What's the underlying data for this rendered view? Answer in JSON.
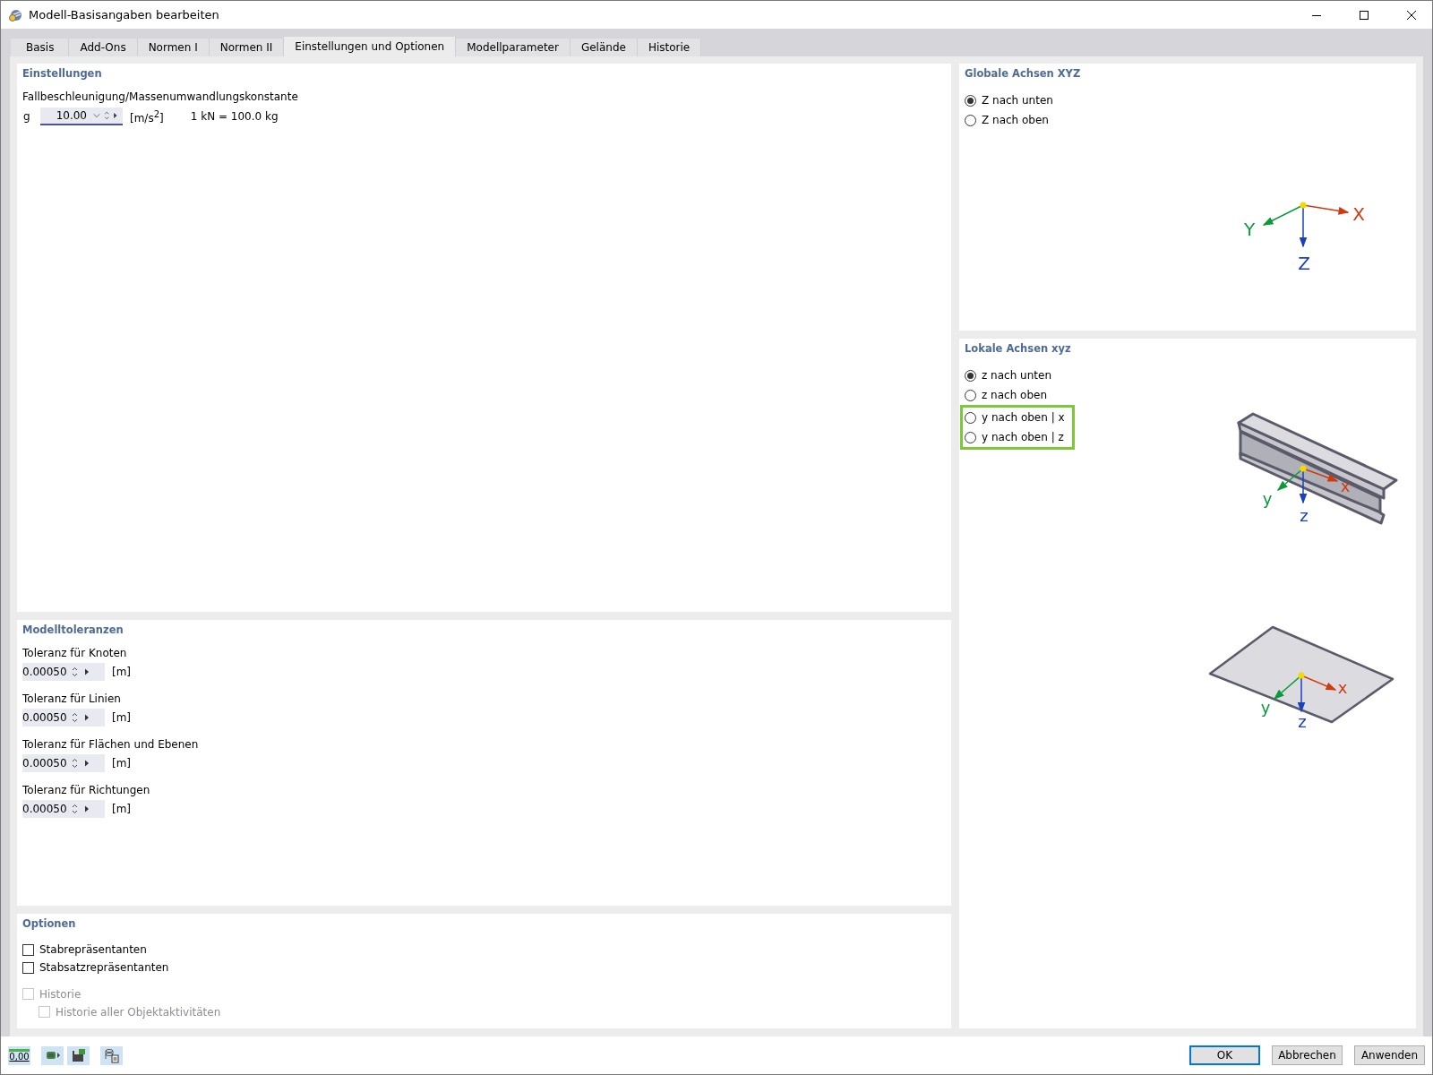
{
  "window": {
    "title": "Modell-Basisangaben bearbeiten"
  },
  "tabs": [
    {
      "label": "Basis",
      "selected": false
    },
    {
      "label": "Add-Ons",
      "selected": false
    },
    {
      "label": "Normen I",
      "selected": false
    },
    {
      "label": "Normen II",
      "selected": false
    },
    {
      "label": "Einstellungen und Optionen",
      "selected": true
    },
    {
      "label": "Modellparameter",
      "selected": false
    },
    {
      "label": "Gelände",
      "selected": false
    },
    {
      "label": "Historie",
      "selected": false
    }
  ],
  "settings": {
    "title": "Einstellungen",
    "label": "Fallbeschleunigung/Massenumwandlungskonstante",
    "symbol": "g",
    "value": "10.00",
    "focused": true,
    "unit": "[m/s$^{2}$]",
    "note": "1 kN = 100.0 kg"
  },
  "tolerances": {
    "title": "Modelltoleranzen",
    "items": [
      {
        "label": "Toleranz für Knoten",
        "value": "0.00050",
        "unit": "[m]"
      },
      {
        "label": "Toleranz für Linien",
        "value": "0.00050",
        "unit": "[m]"
      },
      {
        "label": "Toleranz für Flächen und Ebenen",
        "value": "0.00050",
        "unit": "[m]"
      },
      {
        "label": "Toleranz für Richtungen",
        "value": "0.00050",
        "unit": "[m]"
      }
    ]
  },
  "options": {
    "title": "Optionen",
    "items": [
      {
        "label": "Stabrepräsentanten",
        "checked": false,
        "disabled": false
      },
      {
        "label": "Stabsatzrepräsentanten",
        "checked": false,
        "disabled": false
      },
      {
        "label": "Historie",
        "checked": false,
        "disabled": true,
        "children": [
          {
            "label": "Historie aller Objektaktivitäten",
            "checked": false,
            "disabled": true
          }
        ]
      }
    ]
  },
  "global_axes": {
    "title": "Globale Achsen XYZ",
    "options": [
      {
        "label": "Z nach unten",
        "selected": true
      },
      {
        "label": "Z nach oben",
        "selected": false
      }
    ],
    "axis_labels": [
      "X",
      "Y",
      "Z"
    ]
  },
  "local_axes": {
    "title": "Lokale Achsen xyz",
    "options": [
      {
        "label": "z nach unten",
        "selected": true,
        "highlighted": false
      },
      {
        "label": "z nach oben",
        "selected": false,
        "highlighted": false
      },
      {
        "label": "y nach oben | x",
        "selected": false,
        "highlighted": true
      },
      {
        "label": "y nach oben | z",
        "selected": false,
        "highlighted": true
      }
    ],
    "beam_labels": [
      "x",
      "y",
      "z"
    ],
    "plate_labels": [
      "x",
      "y",
      "z"
    ]
  },
  "footer_tools": [
    {
      "kind": "decimals",
      "text": "0,00"
    },
    {
      "kind": "model"
    },
    {
      "kind": "save"
    },
    {
      "kind": "database"
    }
  ],
  "buttons": [
    {
      "label": "OK",
      "default": true
    },
    {
      "label": "Abbrechen",
      "default": false
    },
    {
      "label": "Anwenden",
      "default": false
    }
  ]
}
